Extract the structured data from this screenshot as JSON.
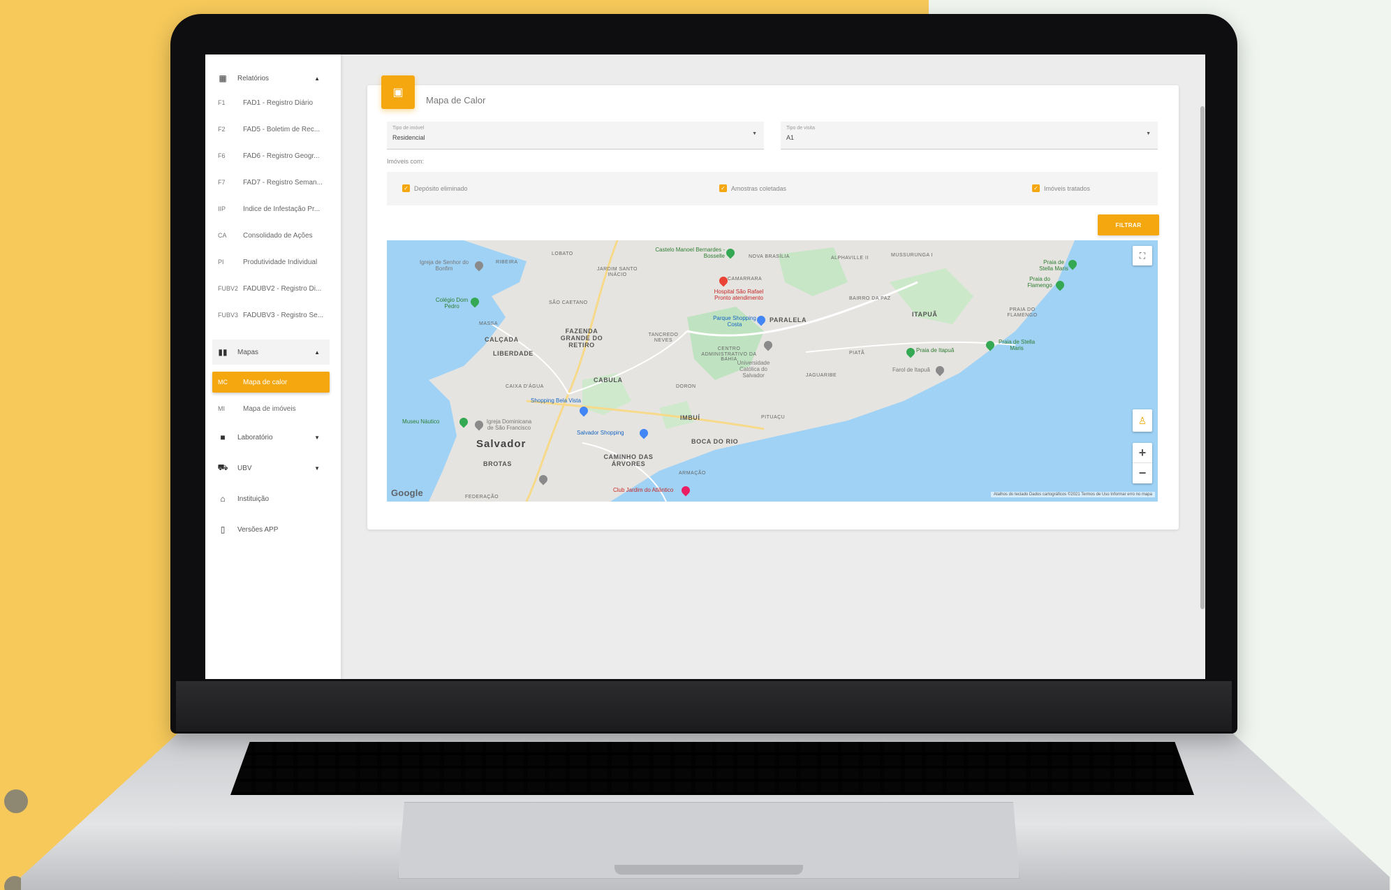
{
  "theme": {
    "accent": "#f5a70f",
    "page_bg": "#f6c95a"
  },
  "sidebar": {
    "groups": [
      {
        "icon": "report-icon",
        "label": "Relatórios",
        "expanded": true
      },
      {
        "icon": "map-icon",
        "label": "Mapas",
        "expanded": true
      },
      {
        "icon": "lab-icon",
        "label": "Laboratório",
        "expanded": false
      },
      {
        "icon": "ubv-icon",
        "label": "UBV",
        "expanded": false
      },
      {
        "icon": "institution-icon",
        "label": "Instituição"
      },
      {
        "icon": "phone-icon",
        "label": "Versões APP"
      }
    ],
    "report_items": [
      {
        "abbr": "F1",
        "label": "FAD1 - Registro Diário"
      },
      {
        "abbr": "F2",
        "label": "FAD5 - Boletim de Rec..."
      },
      {
        "abbr": "F6",
        "label": "FAD6 - Registro Geogr..."
      },
      {
        "abbr": "F7",
        "label": "FAD7 - Registro Seman..."
      },
      {
        "abbr": "IIP",
        "label": "Índice de Infestação Pr..."
      },
      {
        "abbr": "CA",
        "label": "Consolidado de Ações"
      },
      {
        "abbr": "PI",
        "label": "Produtividade Individual"
      },
      {
        "abbr": "FUBV2",
        "label": "FADUBV2 - Registro Di..."
      },
      {
        "abbr": "FUBV3",
        "label": "FADUBV3 - Registro Se..."
      }
    ],
    "map_items": [
      {
        "abbr": "MC",
        "label": "Mapa de calor",
        "active": true
      },
      {
        "abbr": "MI",
        "label": "Mapa de imóveis",
        "active": false
      }
    ]
  },
  "main": {
    "title": "Mapa de Calor",
    "property_type": {
      "label": "Tipo de imóvel",
      "value": "Residencial"
    },
    "visit_type": {
      "label": "Tipo de visita",
      "value": "A1"
    },
    "subhead": "Imóveis com:",
    "checkboxes": [
      {
        "label": "Depósito eliminado",
        "checked": true
      },
      {
        "label": "Amostras coletadas",
        "checked": true
      },
      {
        "label": "Imóveis tratados",
        "checked": true
      }
    ],
    "filter_button": "FILTRAR"
  },
  "map": {
    "neighborhoods": [
      "CALÇADA",
      "LIBERDADE",
      "FAZENDA GRANDE DO RETIRO",
      "CABULA",
      "Salvador",
      "BROTAS",
      "CAMINHO DAS ÁRVORES",
      "BOCA DO RIO",
      "IMBUÍ",
      "PARALELA",
      "ITAPUÃ",
      "SÃO CAETANO",
      "LOBATO",
      "JARDIM SANTO INÁCIO",
      "NOVA BRASÍLIA",
      "MUSSURUNGA I",
      "ALPHAVILLE II",
      "CENTRO ADMINISTRATIVO DA BAHIA",
      "TANCREDO NEVES",
      "DORON",
      "PITUAÇU",
      "JAGUARIBE",
      "PIATÃ",
      "PRAIA DO FLAMENGO",
      "RIBEIRA",
      "CAMARRARA",
      "BAIRRO DA PAZ",
      "CAIXA D'ÁGUA",
      "FEDERAÇÃO",
      "ARMAÇÃO",
      "MASSA"
    ],
    "places": [
      {
        "name": "Castelo Manoel Bernardes - Bosselle",
        "kind": "green"
      },
      {
        "name": "Hospital São Rafael Pronto atendimento",
        "kind": "red"
      },
      {
        "name": "Praia de Stella Maris",
        "kind": "green"
      },
      {
        "name": "Praia do Flamengo",
        "kind": "green"
      },
      {
        "name": "Praia de Itapuã",
        "kind": "green"
      },
      {
        "name": "Praia de Stella Maris",
        "kind": "green"
      },
      {
        "name": "Farol de Itapuã",
        "kind": "grey"
      },
      {
        "name": "Shopping Bela Vista",
        "kind": "blue"
      },
      {
        "name": "Salvador Shopping",
        "kind": "blue"
      },
      {
        "name": "Universidade Católica do Salvador",
        "kind": "grey"
      },
      {
        "name": "Parque Shopping Costa",
        "kind": "blue"
      },
      {
        "name": "Igreja Dominicana de São Francisco",
        "kind": "grey"
      },
      {
        "name": "Museu Náutico",
        "kind": "green"
      },
      {
        "name": "Colégio Dom Pedro",
        "kind": "green"
      },
      {
        "name": "Igreja de Senhor do Bonfim",
        "kind": "grey"
      },
      {
        "name": "Club Jardim do Atlântico",
        "kind": "pink"
      }
    ],
    "google_label": "Google",
    "attribution": "Atalhos do teclado   Dados cartográficos ©2021   Termos de Uso   Informar erro no mapa"
  }
}
